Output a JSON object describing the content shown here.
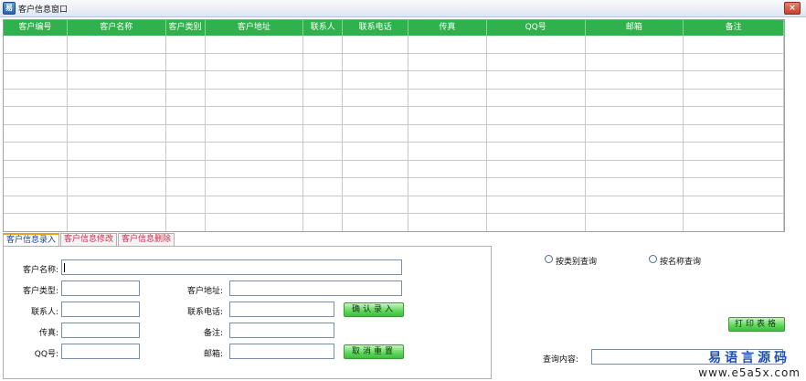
{
  "window": {
    "title": "客户信息窗口",
    "icon": "app-icon",
    "close_label": "×"
  },
  "grid": {
    "columns": [
      "客户编号",
      "客户名称",
      "客户类别",
      "客户地址",
      "联系人",
      "联系电话",
      "传真",
      "QQ号",
      "邮箱",
      "备注"
    ],
    "header_color": "#2fb24b",
    "rows": []
  },
  "tabs": [
    "客户信息录入",
    "客户信息修改",
    "客户信息删除"
  ],
  "form": {
    "customer_name_label": "客户名称:",
    "customer_name_value": "",
    "customer_type_label": "客户类型:",
    "customer_type_value": "",
    "customer_address_label": "客户地址:",
    "customer_address_value": "",
    "contact_label": "联系人:",
    "contact_value": "",
    "phone_label": "联系电话:",
    "phone_value": "",
    "fax_label": "传真:",
    "fax_value": "",
    "remark_label": "备注:",
    "remark_value": "",
    "qq_label": "QQ号:",
    "qq_value": "",
    "email_label": "邮箱:",
    "email_value": "",
    "confirm_button": "确认录入",
    "reset_button": "取消重置"
  },
  "query": {
    "by_category": "按类别查询",
    "by_name": "按名称查询",
    "print_button": "打印表格",
    "content_label": "查询内容:",
    "content_value": ""
  },
  "watermark": {
    "line1": "易语言源码",
    "line2": "www.e5a5x.com"
  }
}
